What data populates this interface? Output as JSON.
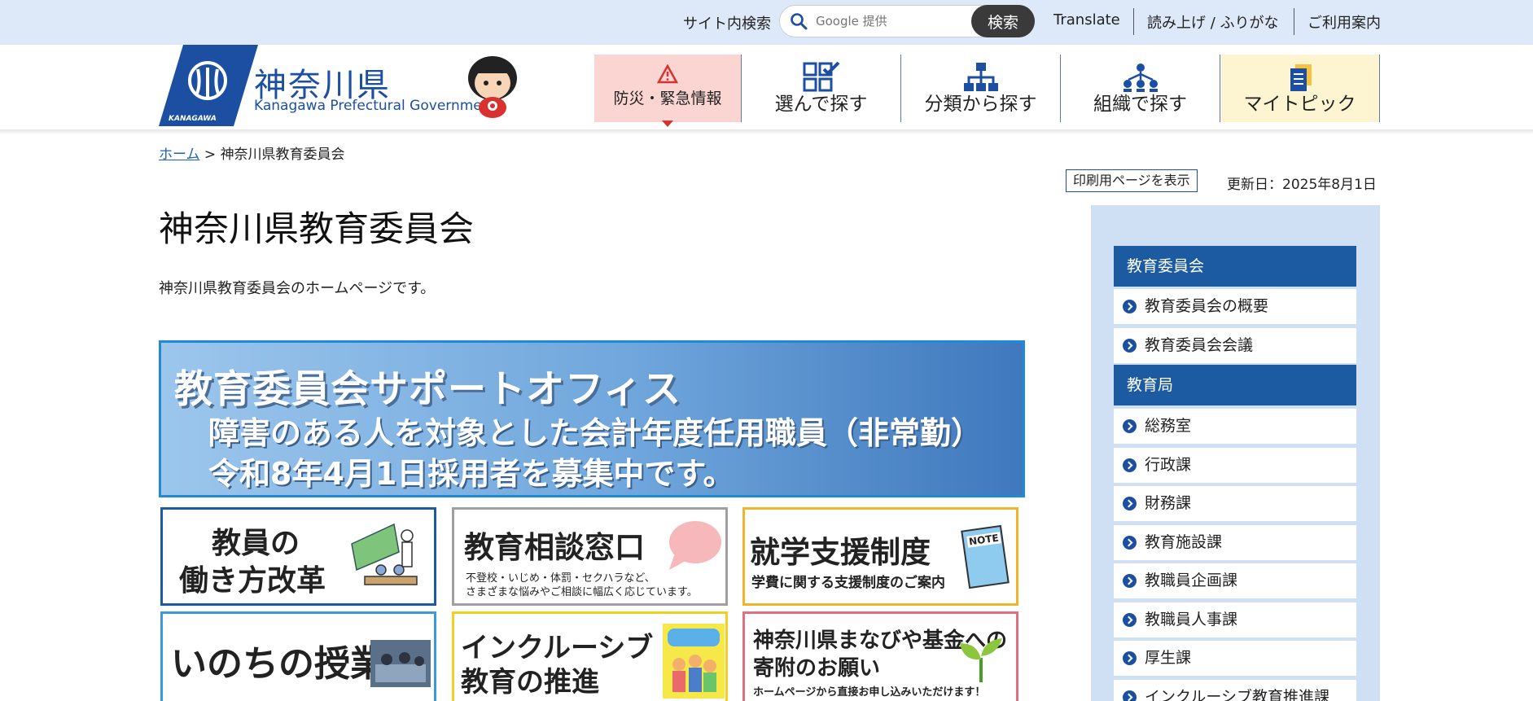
{
  "topbar": {
    "site_search_label": "サイト内検索",
    "search_placeholder": "Google 提供",
    "search_button": "検索",
    "links": [
      "Translate",
      "読み上げ / ふりがな",
      "ご利用案内"
    ]
  },
  "logo": {
    "name_jp": "神奈川県",
    "name_en": "Kanagawa Prefectural Government",
    "mark_text": "KANAGAWA"
  },
  "nav": {
    "emergency": "防災・緊急情報",
    "items": [
      "選んで探す",
      "分類から探す",
      "組織で探す",
      "マイトピック"
    ]
  },
  "breadcrumb": {
    "home": "ホーム",
    "separator": ">",
    "current": "神奈川県教育委員会"
  },
  "meta": {
    "print_button": "印刷用ページを表示",
    "updated": "更新日：2025年8月1日"
  },
  "page": {
    "title": "神奈川県教育委員会",
    "description": "神奈川県教育委員会のホームページです。"
  },
  "banner": {
    "line1": "教育委員会サポートオフィス",
    "line2": "障害のある人を対象とした会計年度任用職員（非常勤）",
    "line3": "令和8年4月1日採用者を募集中です。"
  },
  "cards": [
    {
      "title_line1": "教員の",
      "title_line2": "働き方改革",
      "border": "#1c5aa2"
    },
    {
      "title": "教育相談窓口",
      "sub_line1": "不登校・いじめ・体罰・セクハラなど、",
      "sub_line2": "さまざまな悩みやご相談に幅広く応じています。",
      "border": "#a0a0a0"
    },
    {
      "title": "就学支援制度",
      "sub": "学費に関する支援制度のご案内",
      "note_label": "NOTE",
      "border": "#f0b429"
    },
    {
      "title": "いのちの授業",
      "border": "#3b9ad9"
    },
    {
      "title_line1": "インクルーシブ",
      "title_line2": "教育の推進",
      "border": "#f0d020"
    },
    {
      "title_line1": "神奈川県まなびや基金への",
      "title_line2": "寄附のお願い",
      "sub": "ホームページから直接お申し込みいただけます！",
      "border": "#e07080"
    }
  ],
  "sidebar": {
    "section1": "教育委員会",
    "section1_items": [
      "教育委員会の概要",
      "教育委員会会議"
    ],
    "section2": "教育局",
    "section2_items": [
      "総務室",
      "行政課",
      "財務課",
      "教育施設課",
      "教職員企画課",
      "教職員人事課",
      "厚生課",
      "インクルーシブ教育推進課"
    ]
  },
  "colors": {
    "brand_blue": "#1c4fa2",
    "topbar_bg": "#dde8f8",
    "emergency_bg": "#fbd5d2",
    "mytopic_bg": "#fdf4d2",
    "sidebar_bg": "#cfe0f4"
  }
}
